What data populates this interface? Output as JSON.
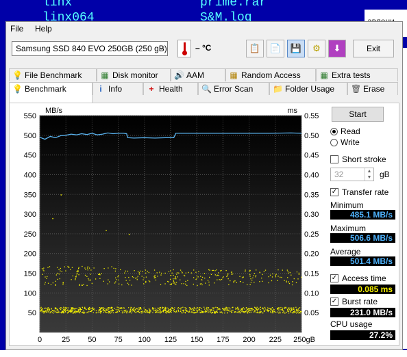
{
  "background": {
    "terminal_lines": [
      "linx",
      "linx064",
      "prime.rar",
      "S&M.log"
    ],
    "right_fragment": "авлени",
    "right_fragment2": "R"
  },
  "menu": {
    "file": "File",
    "help": "Help"
  },
  "toolbar": {
    "drive": "Samsung SSD 840 EVO 250GB (250 gB)",
    "temperature": "– °C",
    "exit": "Exit"
  },
  "tabs_top": [
    "File Benchmark",
    "Disk monitor",
    "AAM",
    "Random Access",
    "Extra tests"
  ],
  "tabs_bottom": [
    "Benchmark",
    "Info",
    "Health",
    "Error Scan",
    "Folder Usage",
    "Erase"
  ],
  "controls": {
    "start": "Start",
    "read": "Read",
    "write": "Write",
    "short_stroke": "Short stroke",
    "stroke_value": "32",
    "stroke_unit": "gB",
    "transfer_rate": "Transfer rate",
    "minimum_label": "Minimum",
    "minimum_value": "485.1 MB/s",
    "maximum_label": "Maximum",
    "maximum_value": "506.6 MB/s",
    "average_label": "Average",
    "average_value": "501.4 MB/s",
    "access_time": "Access time",
    "access_value": "0.085 ms",
    "burst_rate": "Burst rate",
    "burst_value": "231.0 MB/s",
    "cpu_label": "CPU usage",
    "cpu_value": "27.2%"
  },
  "chart_data": {
    "type": "line",
    "ylabel_left": "MB/s",
    "ylabel_right": "ms",
    "y_left_ticks": [
      50,
      100,
      150,
      200,
      250,
      300,
      350,
      400,
      450,
      500,
      550
    ],
    "y_right_ticks": [
      "0.05",
      "0.10",
      "0.15",
      "0.20",
      "0.25",
      "0.30",
      "0.35",
      "0.40",
      "0.45",
      "0.50",
      "0.55"
    ],
    "x_ticks": [
      "0",
      "25",
      "50",
      "75",
      "100",
      "125",
      "150",
      "175",
      "200",
      "225",
      "250gB"
    ],
    "xlim": [
      0,
      250
    ],
    "ylim_left": [
      0,
      550
    ],
    "ylim_right": [
      0,
      0.55
    ],
    "transfer_series": {
      "name": "Transfer rate",
      "x": [
        0,
        5,
        10,
        15,
        20,
        25,
        30,
        35,
        40,
        45,
        50,
        55,
        60,
        65,
        70,
        75,
        80,
        83,
        84,
        90,
        100,
        110,
        120,
        128,
        130,
        140,
        160,
        180,
        200,
        220,
        240,
        250
      ],
      "y": [
        495,
        490,
        497,
        494,
        499,
        500,
        503,
        501,
        504,
        502,
        505,
        501,
        503,
        506,
        504,
        505,
        505,
        504,
        494,
        493,
        494,
        493,
        494,
        494,
        505,
        505,
        505,
        505,
        505,
        505,
        506,
        505
      ]
    },
    "access_band_ms": [
      0.05,
      0.065
    ],
    "access_band_upper_ms": [
      0.12,
      0.17
    ]
  }
}
